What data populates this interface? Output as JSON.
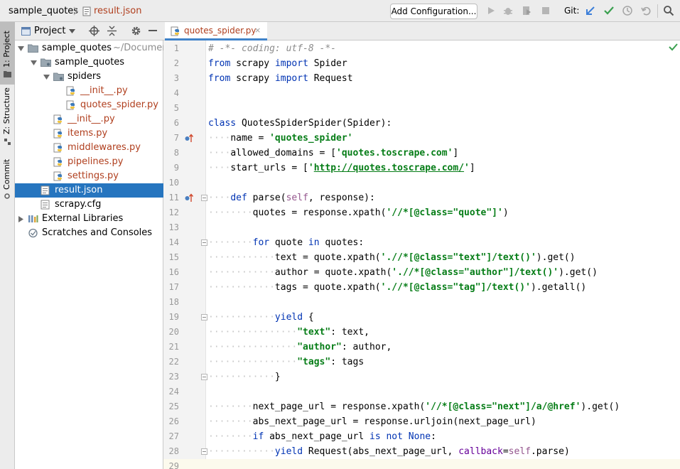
{
  "navbar": {
    "project_name": "sample_quotes",
    "open_file": "result.json",
    "add_configuration": "Add Configuration...",
    "git_label": "Git:"
  },
  "tool_strip": {
    "project_tab": "1: Project",
    "structure_tab": "Z: Structure",
    "commit_tab": "Commit"
  },
  "project_panel": {
    "title": "Project",
    "tree": [
      {
        "label": "sample_quotes",
        "hint": "~/Documer",
        "kind": "folder",
        "expanded": true,
        "depth": 0
      },
      {
        "label": "sample_quotes",
        "kind": "package",
        "expanded": true,
        "depth": 1
      },
      {
        "label": "spiders",
        "kind": "package",
        "expanded": true,
        "depth": 2
      },
      {
        "label": "__init__.py",
        "kind": "python",
        "depth": 3
      },
      {
        "label": "quotes_spider.py",
        "kind": "python",
        "depth": 3
      },
      {
        "label": "__init__.py",
        "kind": "python",
        "depth": 2
      },
      {
        "label": "items.py",
        "kind": "python",
        "depth": 2
      },
      {
        "label": "middlewares.py",
        "kind": "python",
        "depth": 2
      },
      {
        "label": "pipelines.py",
        "kind": "python",
        "depth": 2
      },
      {
        "label": "settings.py",
        "kind": "python",
        "depth": 2
      },
      {
        "label": "result.json",
        "kind": "json",
        "depth": 1,
        "selected": true
      },
      {
        "label": "scrapy.cfg",
        "kind": "cfg",
        "depth": 1
      },
      {
        "label": "External Libraries",
        "kind": "library",
        "collapsed": true,
        "depth": 0
      },
      {
        "label": "Scratches and Consoles",
        "kind": "scratches",
        "depth": 0
      }
    ]
  },
  "editor": {
    "tab_label": "quotes_spider.py",
    "tab_close": "×",
    "line_numbers": [
      "1",
      "2",
      "3",
      "4",
      "5",
      "6",
      "7",
      "8",
      "9",
      "10",
      "11",
      "12",
      "13",
      "14",
      "15",
      "16",
      "17",
      "18",
      "19",
      "20",
      "21",
      "22",
      "23",
      "24",
      "25",
      "26",
      "27",
      "28",
      "29"
    ],
    "code_lines": [
      "# -*- coding: utf-8 -*-",
      "from scrapy import Spider",
      "from scrapy import Request",
      "",
      "",
      "class QuotesSpiderSpider(Spider):",
      "    name = 'quotes_spider'",
      "    allowed_domains = ['quotes.toscrape.com']",
      "    start_urls = ['http://quotes.toscrape.com/']",
      "",
      "    def parse(self, response):",
      "        quotes = response.xpath('//*[@class=\"quote\"]')",
      "",
      "        for quote in quotes:",
      "            text = quote.xpath('.//*[@class=\"text\"]/text()').get()",
      "            author = quote.xpath('.//*[@class=\"author\"]/text()').get()",
      "            tags = quote.xpath('.//*[@class=\"tag\"]/text()').getall()",
      "",
      "            yield {",
      "                \"text\": text,",
      "                \"author\": author,",
      "                \"tags\": tags",
      "            }",
      "",
      "        next_page_url = response.xpath('//*[@class=\"next\"]/a/@href').get()",
      "        abs_next_page_url = response.urljoin(next_page_url)",
      "        if abs_next_page_url is not None:",
      "            yield Request(abs_next_page_url, callback=self.parse)",
      ""
    ]
  },
  "colors": {
    "keyword": "#0033b3",
    "string": "#067d17",
    "comment": "#8c8c8c",
    "selection": "#2675bf",
    "python_file": "#b03f1e"
  }
}
